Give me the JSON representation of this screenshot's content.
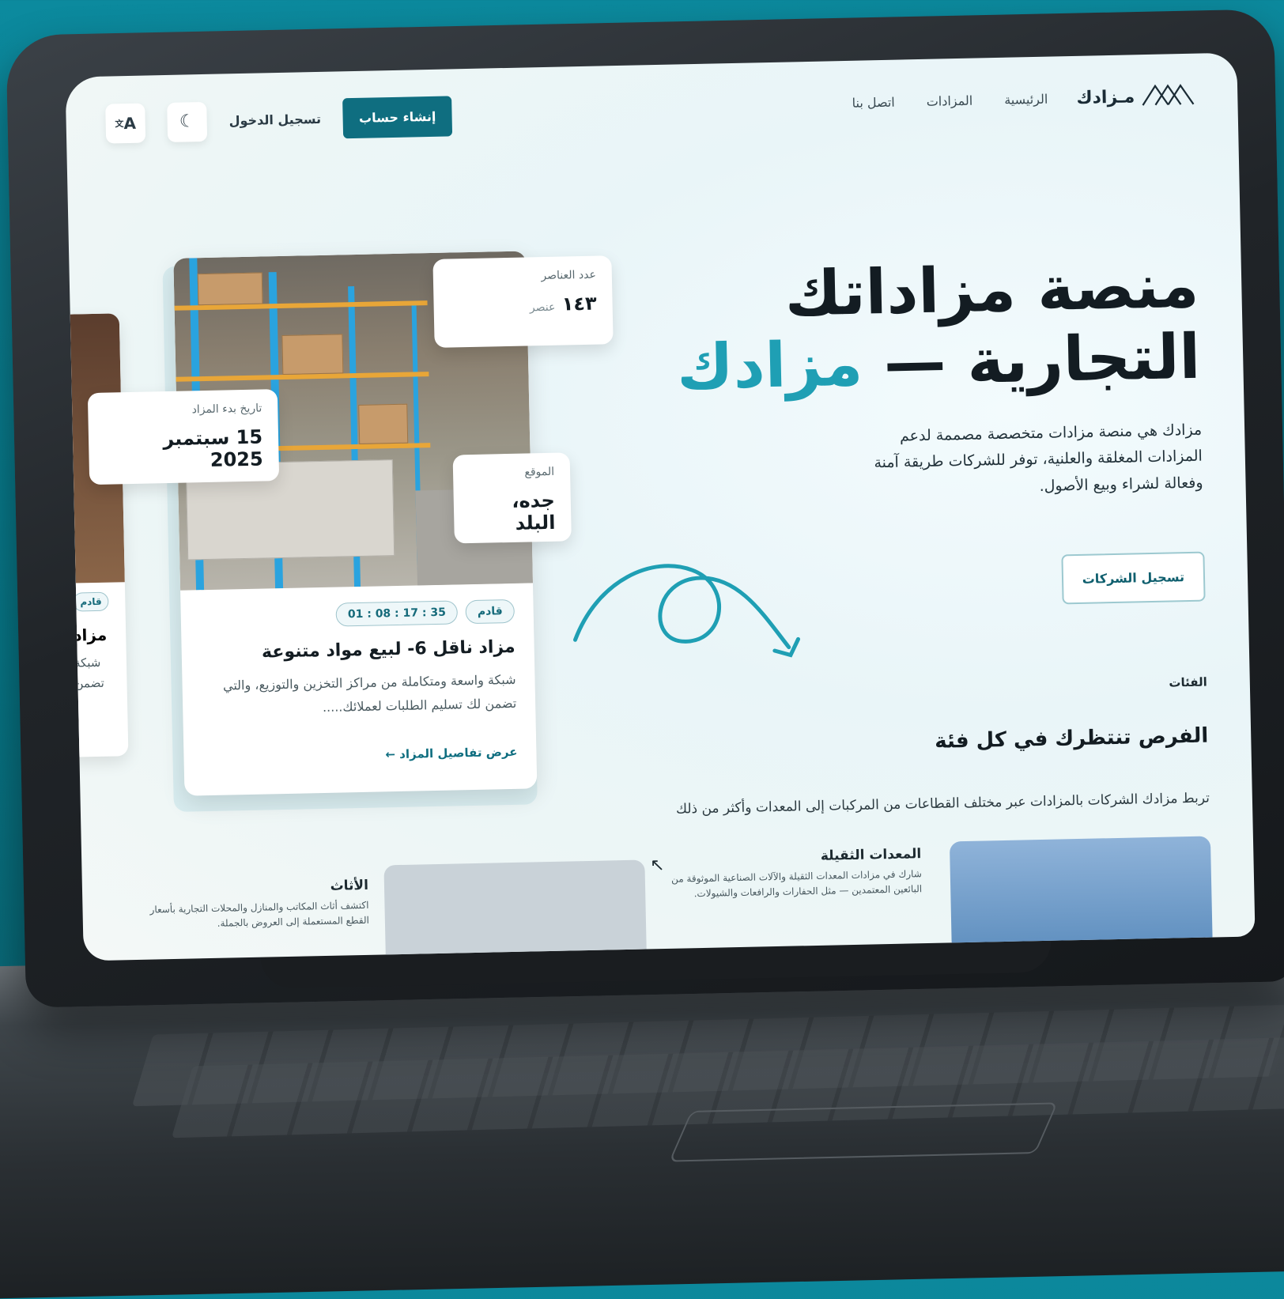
{
  "brand": {
    "name": "مـزادك",
    "logo_icon": "mazadak-logo-icon"
  },
  "nav": {
    "links": [
      "الرئيسية",
      "المزادات",
      "اتصل بنا"
    ]
  },
  "header_actions": {
    "signup_label": "إنشاء حساب",
    "login_label": "تسجيل الدخول",
    "theme_icon": "moon-icon",
    "language_icon": "translate-icon"
  },
  "hero": {
    "title_line1": "منصة مزاداتك",
    "title_line2_dark": "التجارية —",
    "title_line2_accent": "مزادك",
    "description": "مزادك هي منصة مزادات متخصصة مصممة لدعم المزادات المغلقة والعلنية، توفر للشركات طريقة آمنة وفعالة لشراء وبيع الأصول.",
    "companies_button": "تسجيل الشركات"
  },
  "auction_card": {
    "items_label": "عدد العناصر",
    "items_value": "١٤٣",
    "items_unit": "عنصر",
    "start_label": "تاريخ بدء المزاد",
    "start_value": "15 سبتمبر 2025",
    "location_label": "الموقع",
    "location_value": "جده، البلد",
    "status": "قادم",
    "countdown": "01 : 08 : 17 : 35",
    "title": "مزاد ناقل 6- لبيع مواد متنوعة",
    "description": "شبكة واسعة ومتكاملة من مراكز التخزين والتوزيع، والتي تضمن لك تسليم الطلبات لعملائك.....",
    "link": "عرض تفاصيل المزاد"
  },
  "partial_card": {
    "status": "قادم",
    "title": "مزاد",
    "line1": "شبكة",
    "line2": "تضمن"
  },
  "categories": {
    "label": "الفئات",
    "title": "الفرص تنتظرك في كل فئة",
    "description": "تربط مزادك الشركات بالمزادات عبر مختلف القطاعات من المركبات إلى المعدات وأكثر من ذلك",
    "items": [
      {
        "title": "المعدات الثقيلة",
        "desc": "شارك في مزادات المعدات الثقيلة والآلات الصناعية الموثوقة من البائعين المعتمدين — مثل الحفارات والرافعات والشيولات."
      },
      {
        "title": "الأثاث",
        "desc": "اكتشف أثاث المكاتب والمنازل والمحلات التجارية بأسعار القطع المستعملة إلى العروض بالجملة."
      }
    ]
  },
  "colors": {
    "primary": "#0f6e80",
    "accent": "#1f9fb4",
    "dark": "#131c22"
  }
}
